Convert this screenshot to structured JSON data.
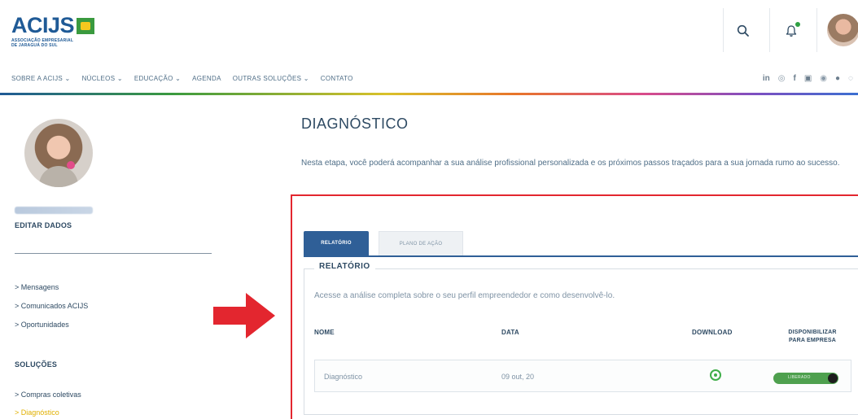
{
  "brand": {
    "logo_text": "ACIJS",
    "logo_sub_1": "ASSOCIAÇÃO EMPRESARIAL",
    "logo_sub_2": "DE JARAGUÁ DO SUL",
    "colors": {
      "primary": "#1f5a96",
      "green": "#3a9a3f",
      "yellow": "#f4c81f",
      "accent_red": "#e3262f"
    }
  },
  "header": {
    "icons": [
      "search-icon",
      "bell-icon",
      "user-avatar"
    ]
  },
  "nav": {
    "items": [
      "SOBRE A ACIJS ⌄",
      "NÚCLEOS ⌄",
      "EDUCAÇÃO ⌄",
      "AGENDA",
      "OUTRAS SOLUÇÕES ⌄",
      "CONTATO"
    ],
    "social": [
      "in",
      "◎",
      "f",
      "▣",
      "◉",
      "●",
      "◌"
    ]
  },
  "sidebar": {
    "edit_label": "EDITAR DADOS",
    "links": [
      "> Mensagens",
      "> Comunicados ACIJS",
      "> Oportunidades"
    ],
    "section_title": "SOLUÇÕES",
    "solution_links": [
      "> Compras coletivas",
      "> Diagnóstico"
    ]
  },
  "main": {
    "title": "DIAGNÓSTICO",
    "intro": "Nesta etapa, você poderá acompanhar a sua análise profissional personalizada e os próximos passos traçados para a sua jornada rumo ao sucesso.",
    "tabs": [
      {
        "label": "RELATÓRIO",
        "active": true
      },
      {
        "label": "PLANO DE AÇÃO",
        "active": false
      }
    ],
    "section_title": "RELATÓRIO",
    "section_desc": "Acesse a análise completa sobre o seu perfil empreendedor e como desenvolvê-lo.",
    "table": {
      "headers": [
        "NOME",
        "DATA",
        "DOWNLOAD",
        "DISPONIBILIZAR",
        "PARA EMPRESA"
      ],
      "rows": [
        {
          "nome": "Diagnóstico",
          "data": "09 out, 20",
          "download_icon": "download-icon",
          "toggle_label": "LIBERADO",
          "toggle_on": true
        }
      ]
    }
  }
}
